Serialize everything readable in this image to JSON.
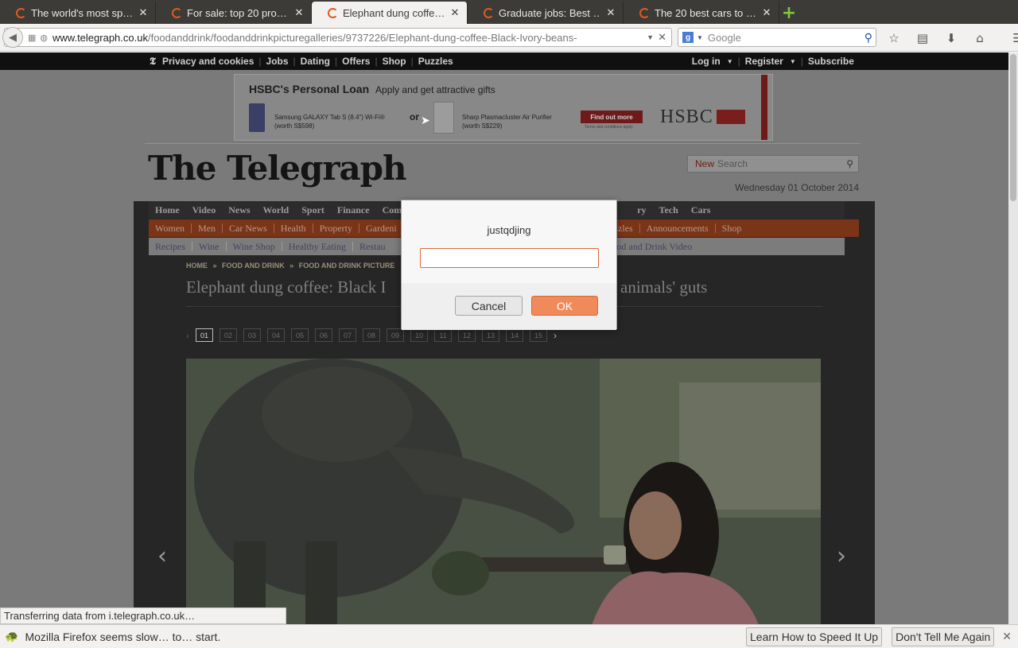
{
  "tabs": [
    {
      "title": "The world's most sp…",
      "active": false
    },
    {
      "title": "For sale: top 20 pro…",
      "active": false
    },
    {
      "title": "Elephant dung coffe…",
      "active": true
    },
    {
      "title": "Graduate jobs: Best …",
      "active": false
    },
    {
      "title": "The 20 best cars to …",
      "active": false
    }
  ],
  "urlbar": {
    "domain": "www.telegraph.co.uk",
    "path": "/foodanddrink/foodanddrinkpicturegalleries/9737226/Elephant-dung-coffee-Black-Ivory-beans-"
  },
  "searchbar": {
    "placeholder": "Google"
  },
  "topnav": {
    "left": [
      "Privacy and cookies",
      "Jobs",
      "Dating",
      "Offers",
      "Shop",
      "Puzzles"
    ],
    "right": [
      "Log in",
      "Register",
      "Subscribe"
    ]
  },
  "ad": {
    "title": "HSBC's Personal Loan",
    "subtitle": "Apply and get attractive gifts",
    "item1_name": "Samsung GALAXY Tab S (8.4\") Wi-Fi®",
    "item1_worth": "(worth S$598)",
    "or": "or",
    "item2_name": "Sharp Plasmacluster Air Purifier",
    "item2_worth": "(worth S$229)",
    "cta": "Find out more",
    "terms": "Terms and conditions apply",
    "brand": "HSBC"
  },
  "masthead": {
    "logo": "The Telegraph",
    "search_new": "New",
    "search_placeholder": "Search",
    "date": "Wednesday 01 October 2014"
  },
  "menu_main": [
    "Home",
    "Video",
    "News",
    "World",
    "Sport",
    "Finance",
    "Comment",
    "ry",
    "Tech",
    "Cars"
  ],
  "menu_section": [
    "Women",
    "Men",
    "Car News",
    "Health",
    "Property",
    "Gardeni",
    "zzles",
    "Announcements",
    "Shop"
  ],
  "menu_sub": [
    "Recipes",
    "Wine",
    "Wine Shop",
    "Healthy Eating",
    "Restau",
    "Food and Drink Video"
  ],
  "breadcrumb": [
    "HOME",
    "FOOD AND DRINK",
    "FOOD AND DRINK PICTURE"
  ],
  "headline_left": "Elephant dung coffee: Black I",
  "headline_right": "animals' guts",
  "pager": [
    "01",
    "02",
    "03",
    "04",
    "05",
    "06",
    "07",
    "08",
    "09",
    "10",
    "11",
    "12",
    "13",
    "14",
    "15"
  ],
  "status": {
    "loading": "Transferring data from i.telegraph.co.uk…"
  },
  "notification": {
    "message": "Mozilla Firefox seems slow… to… start.",
    "button_learn": "Learn How to Speed It Up",
    "button_dismiss": "Don't Tell Me Again"
  },
  "dialog": {
    "message": "justqdjing",
    "input_value": "",
    "cancel": "Cancel",
    "ok": "OK"
  },
  "colors": {
    "accent": "#e05a1d",
    "ok_button": "#f08a5a",
    "section_menu": "#b73f12"
  }
}
